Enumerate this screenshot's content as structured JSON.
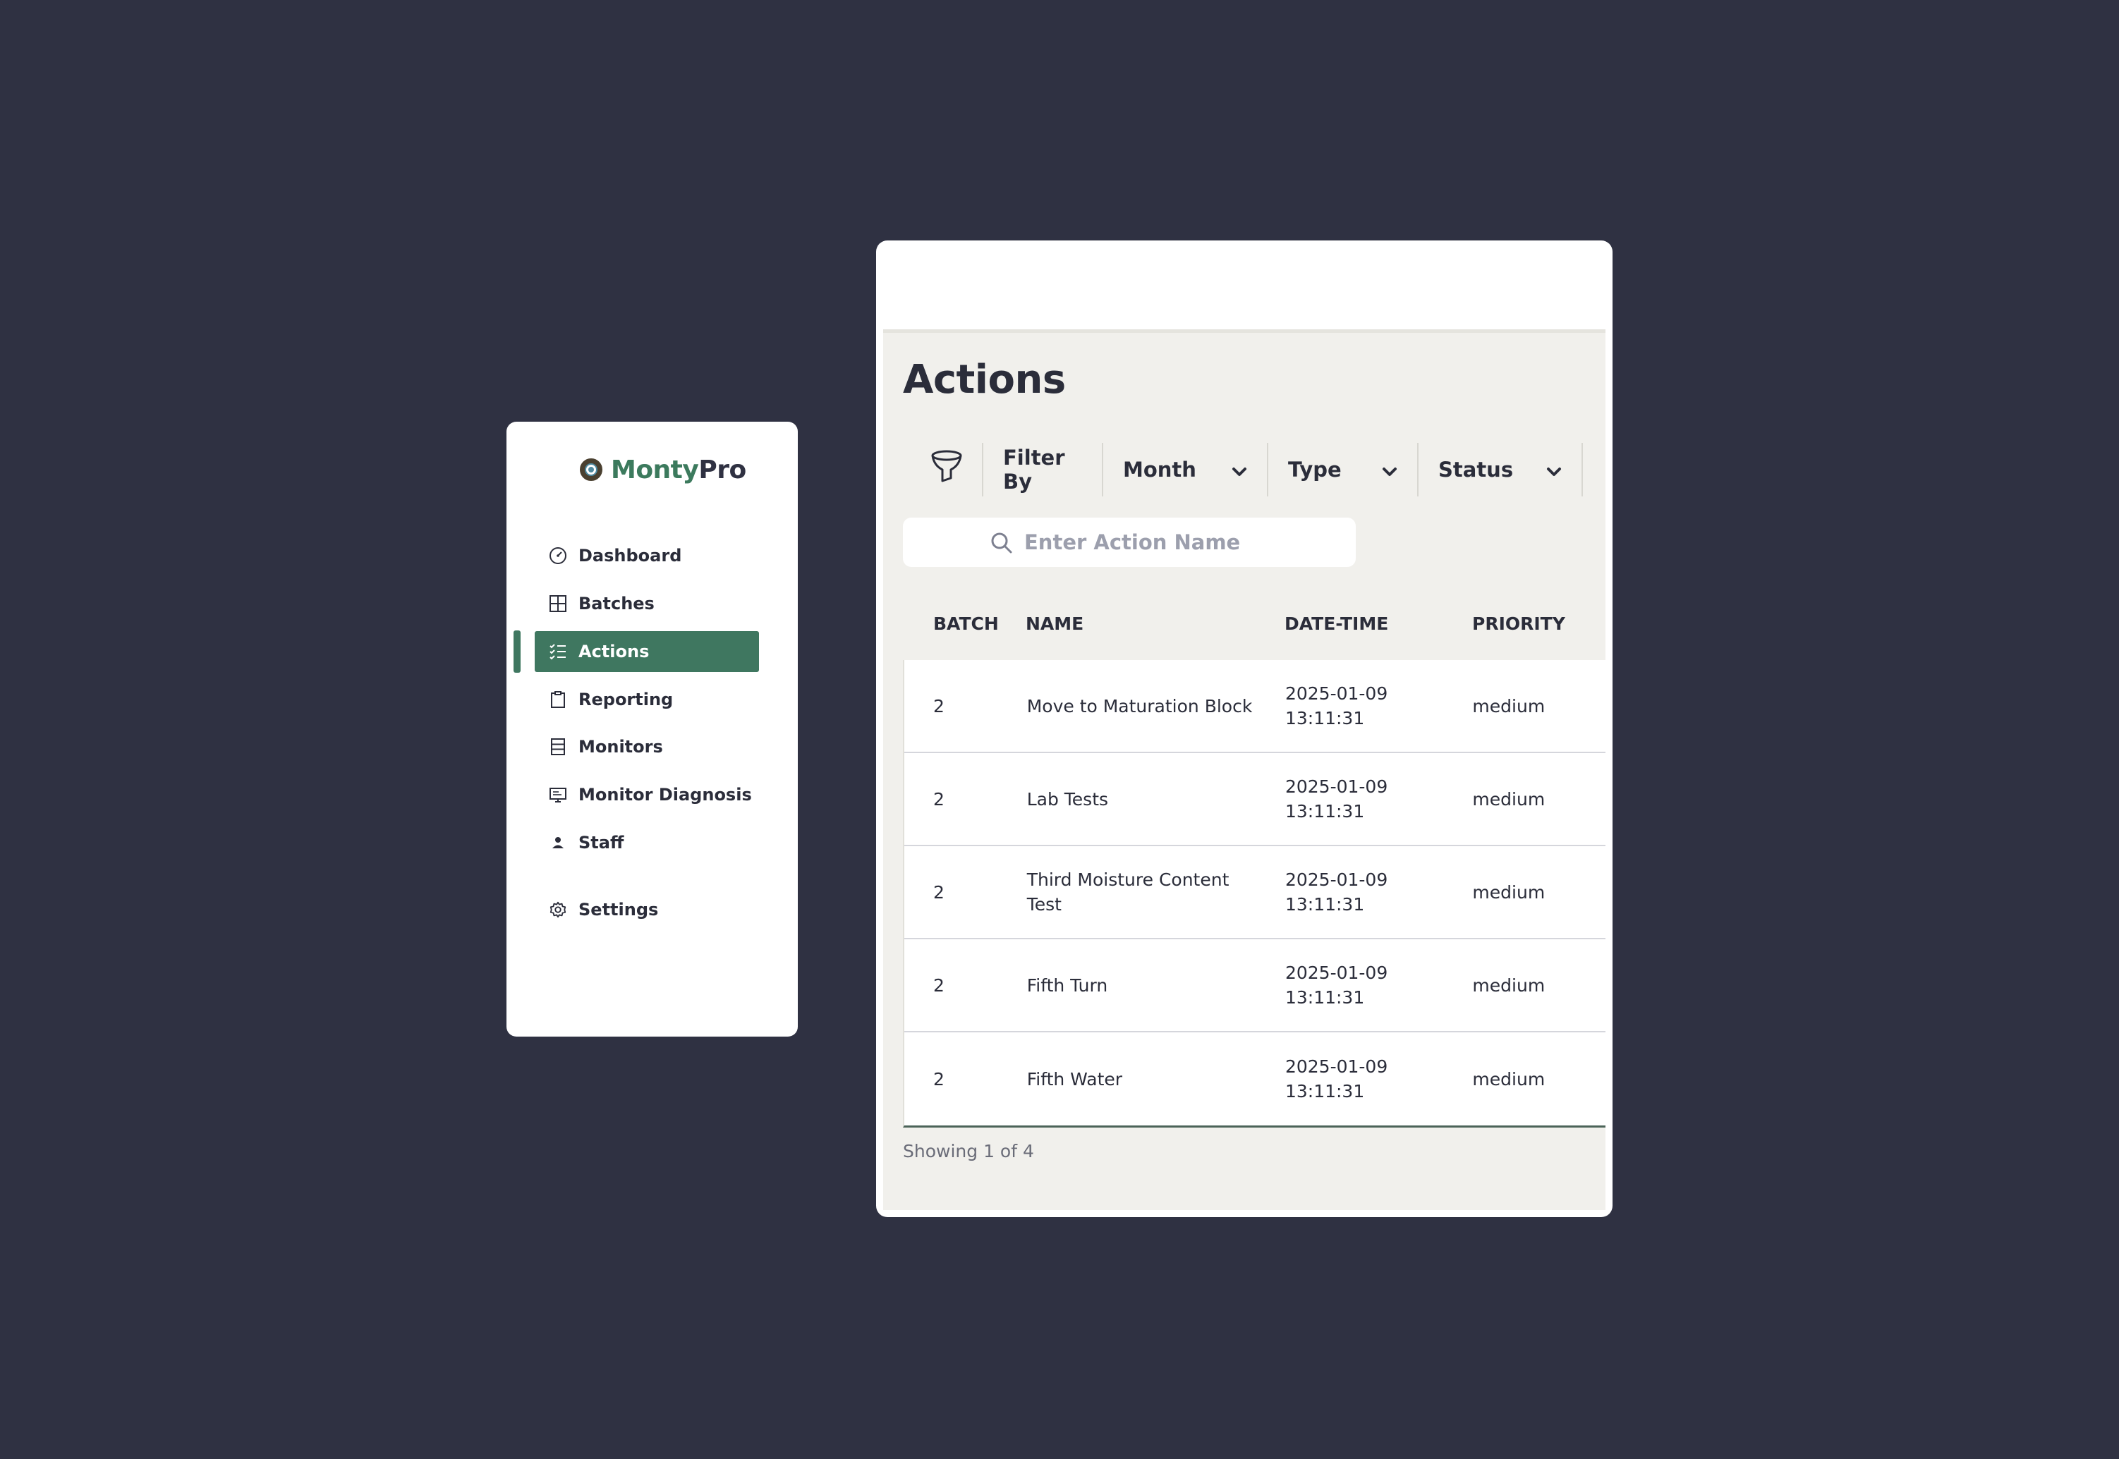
{
  "brand": {
    "name_part1": "Monty",
    "name_part2": "Pro"
  },
  "sidebar": {
    "items": [
      {
        "label": "Dashboard",
        "icon": "gauge-icon"
      },
      {
        "label": "Batches",
        "icon": "grid-icon"
      },
      {
        "label": "Actions",
        "icon": "checklist-icon",
        "active": true
      },
      {
        "label": "Reporting",
        "icon": "clipboard-icon"
      },
      {
        "label": "Monitors",
        "icon": "server-icon"
      },
      {
        "label": "Monitor Diagnosis",
        "icon": "monitor-icon"
      },
      {
        "label": "Staff",
        "icon": "user-icon"
      },
      {
        "label": "Settings",
        "icon": "gear-icon"
      }
    ]
  },
  "main": {
    "title": "Actions",
    "filters": {
      "filter_by": "Filter By",
      "month": "Month",
      "type": "Type",
      "status": "Status"
    },
    "search": {
      "placeholder": "Enter Action Name",
      "value": ""
    },
    "table": {
      "headers": [
        "BATCH",
        "NAME",
        "DATE-TIME",
        "PRIORITY"
      ],
      "rows": [
        {
          "batch": "2",
          "name": "Move to Maturation Block",
          "date": "2025-01-09",
          "time": "13:11:31",
          "priority": "medium"
        },
        {
          "batch": "2",
          "name": "Lab Tests",
          "date": "2025-01-09",
          "time": "13:11:31",
          "priority": "medium"
        },
        {
          "batch": "2",
          "name": "Third Moisture Content Test",
          "date": "2025-01-09",
          "time": "13:11:31",
          "priority": "medium"
        },
        {
          "batch": "2",
          "name": "Fifth Turn",
          "date": "2025-01-09",
          "time": "13:11:31",
          "priority": "medium"
        },
        {
          "batch": "2",
          "name": "Fifth Water",
          "date": "2025-01-09",
          "time": "13:11:31",
          "priority": "medium"
        }
      ]
    },
    "pagination_text": "Showing 1 of 4"
  },
  "colors": {
    "background": "#2f3142",
    "accent_green": "#3f7760",
    "panel": "#f1f0ec",
    "text": "#2b2d3a"
  }
}
